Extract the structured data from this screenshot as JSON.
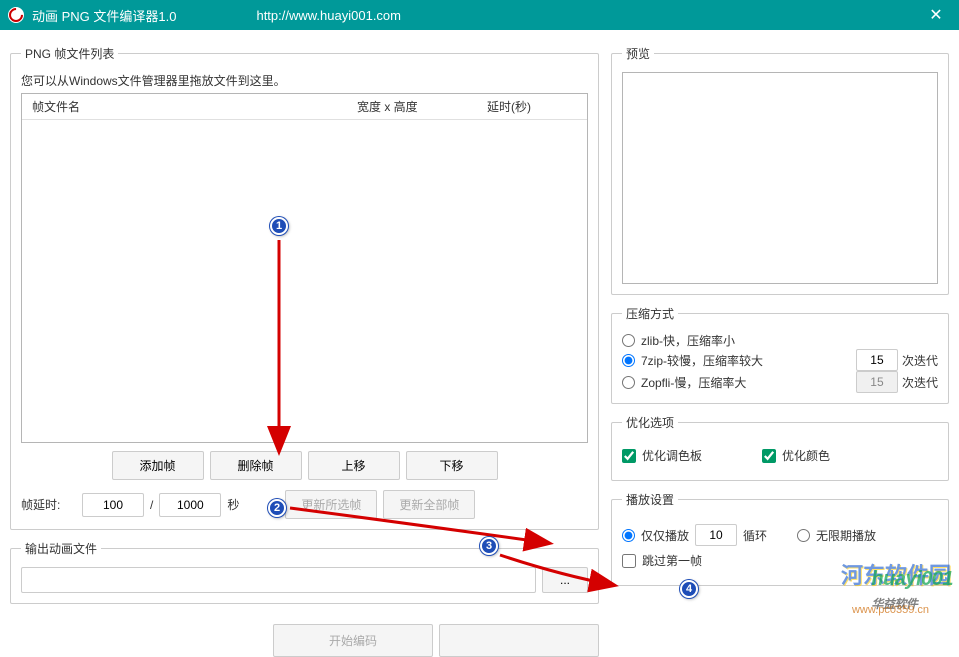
{
  "titlebar": {
    "title": "动画 PNG 文件编译器1.0",
    "url": "http://www.huayi001.com",
    "close": "✕"
  },
  "frame_list": {
    "legend": "PNG 帧文件列表",
    "hint": "您可以从Windows文件管理器里拖放文件到这里。",
    "col_filename": "帧文件名",
    "col_dimensions": "宽度 x 高度",
    "col_delay": "延时(秒)",
    "add_btn": "添加帧",
    "delete_btn": "删除帧",
    "move_up_btn": "上移",
    "move_down_btn": "下移"
  },
  "delay": {
    "label": "帧延时:",
    "value_num": "100",
    "value_den": "1000",
    "unit": "秒",
    "update_selected": "更新所选帧",
    "update_all": "更新全部帧"
  },
  "output": {
    "legend": "输出动画文件",
    "browse": "...",
    "encode": "开始编码"
  },
  "preview": {
    "legend": "预览"
  },
  "compression": {
    "legend": "压缩方式",
    "zlib": "zlib-快，压缩率小",
    "sevenzip": "7zip-较慢，压缩率较大",
    "zopfli": "Zopfli-慢，压缩率大",
    "iter_7zip": "15",
    "iter_zopfli": "15",
    "iter_label": "次迭代"
  },
  "optimization": {
    "legend": "优化选项",
    "palette": "优化调色板",
    "color": "优化颜色"
  },
  "playback": {
    "legend": "播放设置",
    "only_play": "仅仅播放",
    "loop_count": "10",
    "loop_label": "循环",
    "infinite": "无限期播放",
    "skip_first": "跳过第一帧"
  },
  "annotations": {
    "b1": "1",
    "b2": "2",
    "b3": "3",
    "b4": "4"
  }
}
